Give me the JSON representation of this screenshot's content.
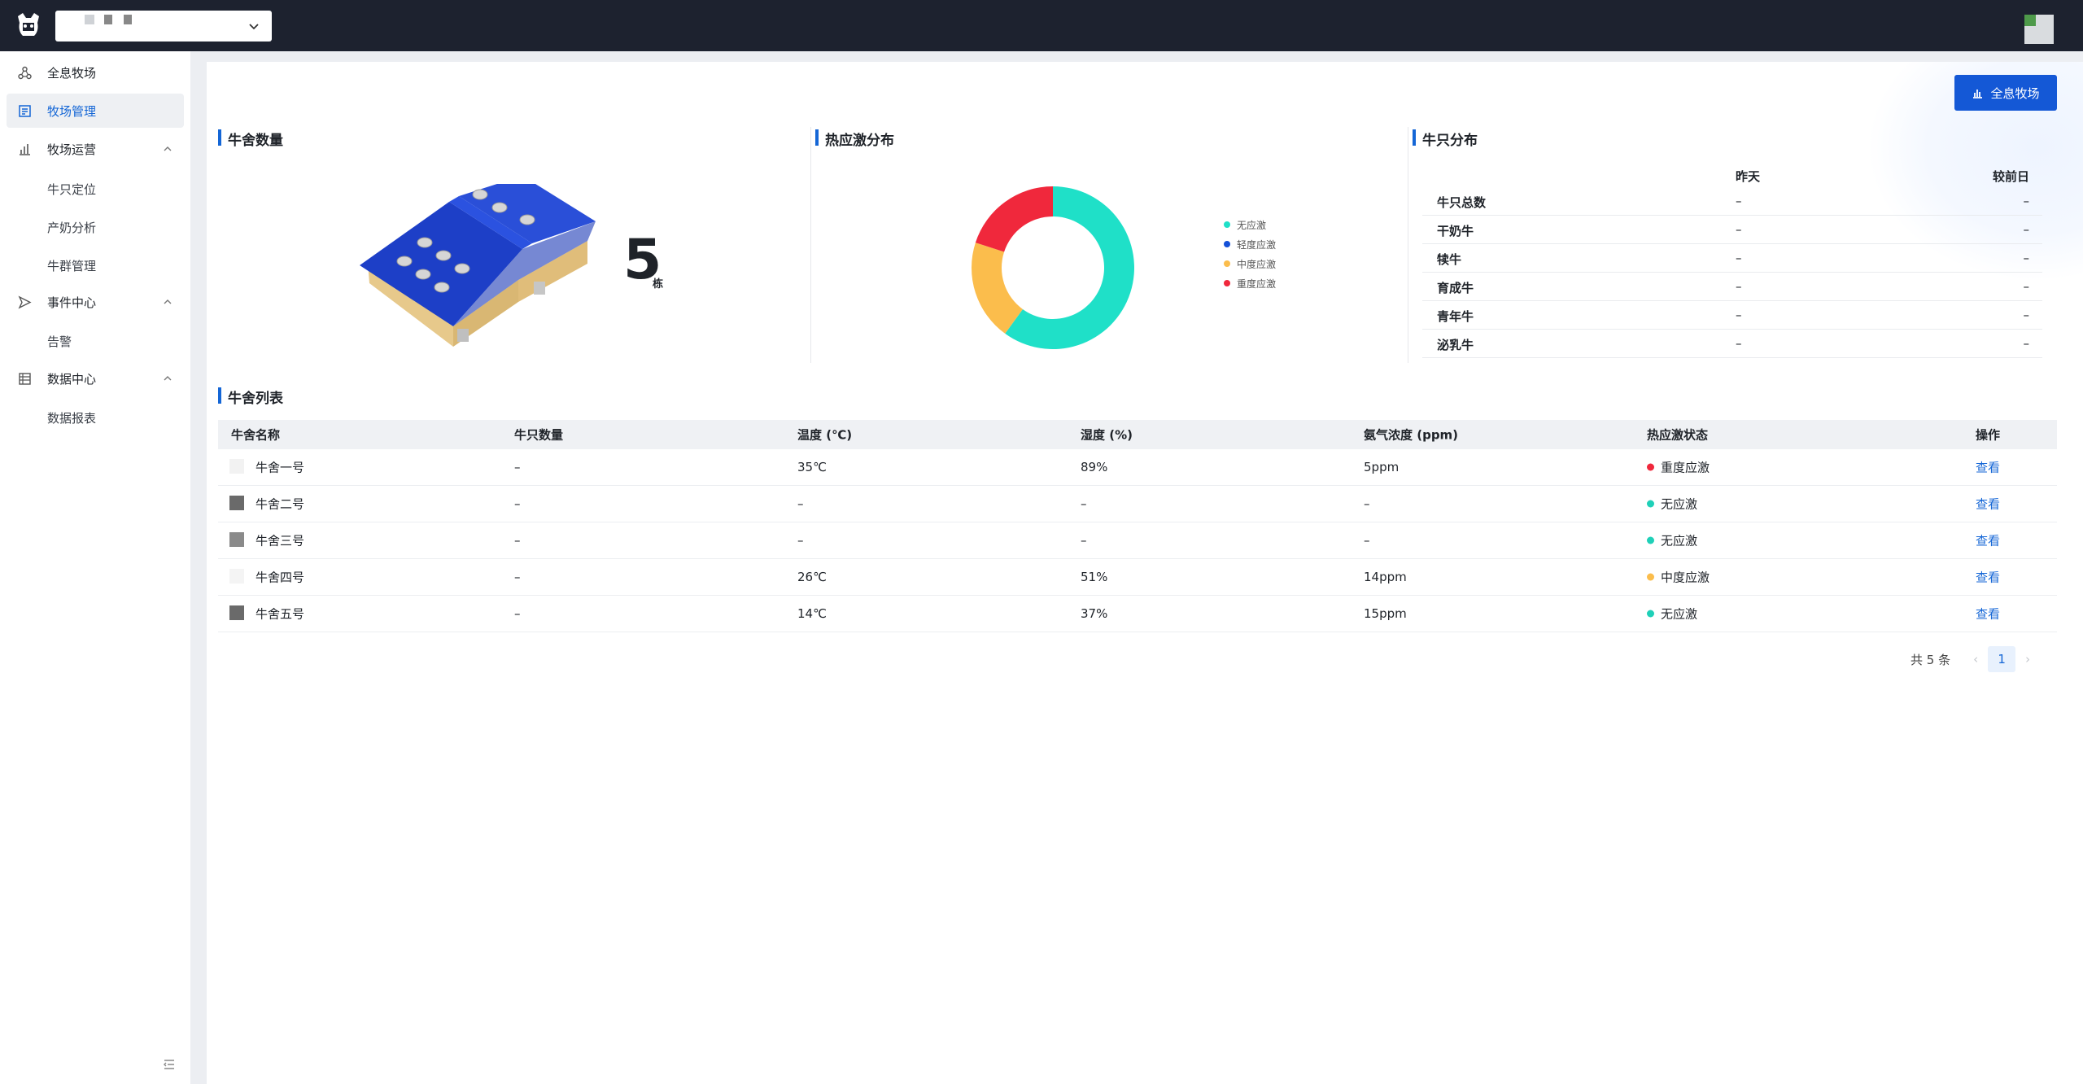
{
  "topbar": {
    "farm_select_value": "",
    "user_avatar": "avatar"
  },
  "sidebar": {
    "items": [
      {
        "label": "全息牧场",
        "icon": "nodes-icon"
      },
      {
        "label": "牧场管理",
        "icon": "farm-doc-icon",
        "active": true
      },
      {
        "label": "牧场运营",
        "icon": "bar-chart-icon",
        "expanded": true,
        "children": [
          "牛只定位",
          "产奶分析",
          "牛群管理"
        ]
      },
      {
        "label": "事件中心",
        "icon": "send-icon",
        "expanded": true,
        "children": [
          "告警"
        ]
      },
      {
        "label": "数据中心",
        "icon": "list-icon",
        "expanded": true,
        "children": [
          "数据报表"
        ]
      }
    ]
  },
  "main": {
    "holo_button": "全息牧场",
    "barn_count": {
      "title": "牛舍数量",
      "value": "5",
      "unit": "栋"
    },
    "heat_stress": {
      "title": "热应激分布",
      "legend": [
        {
          "label": "无应激",
          "color": "#1fe0c8"
        },
        {
          "label": "轻度应激",
          "color": "#1450d8"
        },
        {
          "label": "中度应激",
          "color": "#fbbd4c"
        },
        {
          "label": "重度应激",
          "color": "#f0283c"
        }
      ]
    },
    "cow_distribution": {
      "title": "牛只分布",
      "col_yesterday": "昨天",
      "col_compare": "较前日",
      "rows": [
        {
          "name": "牛只总数",
          "yesterday": "–",
          "compare": "–"
        },
        {
          "name": "干奶牛",
          "yesterday": "–",
          "compare": "–"
        },
        {
          "name": "犊牛",
          "yesterday": "–",
          "compare": "–"
        },
        {
          "name": "育成牛",
          "yesterday": "–",
          "compare": "–"
        },
        {
          "name": "青年牛",
          "yesterday": "–",
          "compare": "–"
        },
        {
          "name": "泌乳牛",
          "yesterday": "–",
          "compare": "–"
        }
      ]
    },
    "barn_list": {
      "title": "牛舍列表",
      "columns": [
        "牛舍名称",
        "牛只数量",
        "温度 (℃)",
        "湿度 (%)",
        "氨气浓度 (ppm)",
        "热应激状态",
        "操作"
      ],
      "rows": [
        {
          "name": "牛舍一号",
          "count": "–",
          "temp": "35℃",
          "humidity": "89%",
          "ammonia": "5ppm",
          "status": "重度应激",
          "status_color": "#f0283c",
          "action": "查看",
          "thumb_color": "#f2f2f2"
        },
        {
          "name": "牛舍二号",
          "count": "–",
          "temp": "–",
          "humidity": "–",
          "ammonia": "–",
          "status": "无应激",
          "status_color": "#1fd0b8",
          "action": "查看",
          "thumb_color": "#6a6a6a"
        },
        {
          "name": "牛舍三号",
          "count": "–",
          "temp": "–",
          "humidity": "–",
          "ammonia": "–",
          "status": "无应激",
          "status_color": "#1fd0b8",
          "action": "查看",
          "thumb_color": "#8a8a8a"
        },
        {
          "name": "牛舍四号",
          "count": "–",
          "temp": "26℃",
          "humidity": "51%",
          "ammonia": "14ppm",
          "status": "中度应激",
          "status_color": "#fbbd4c",
          "action": "查看",
          "thumb_color": "#f4f4f4"
        },
        {
          "name": "牛舍五号",
          "count": "–",
          "temp": "14℃",
          "humidity": "37%",
          "ammonia": "15ppm",
          "status": "无应激",
          "status_color": "#1fd0b8",
          "action": "查看",
          "thumb_color": "#6a6a6a"
        }
      ]
    },
    "pager": {
      "total": "共 5 条",
      "current_page": "1",
      "prev": "‹",
      "next": "›"
    }
  },
  "chart_data": {
    "type": "pie",
    "title": "热应激分布",
    "categories": [
      "无应激",
      "轻度应激",
      "中度应激",
      "重度应激"
    ],
    "values": [
      3,
      0,
      1,
      1
    ],
    "colors": [
      "#1fe0c8",
      "#1450d8",
      "#fbbd4c",
      "#f0283c"
    ],
    "legend": "right"
  }
}
